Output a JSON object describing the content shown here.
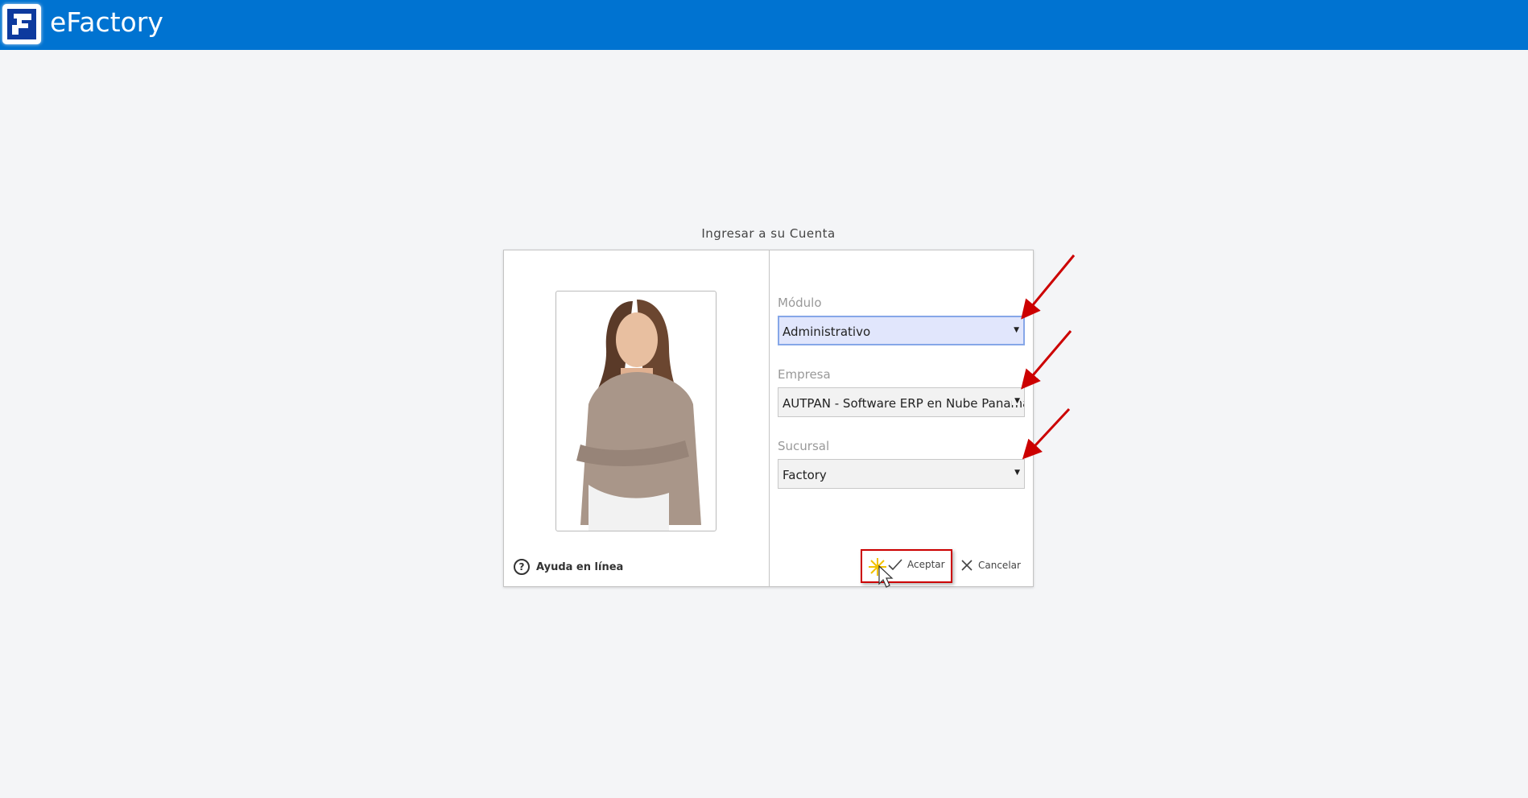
{
  "header": {
    "app_title": "eFactory",
    "logo_icon": "efactory-logo-icon"
  },
  "dialog": {
    "title": "Ingresar a su Cuenta",
    "help_label": "Ayuda en línea",
    "fields": [
      {
        "label": "Módulo",
        "value": "Administrativo"
      },
      {
        "label": "Empresa",
        "value": "AUTPAN - Software ERP en Nube Panamá"
      },
      {
        "label": "Sucursal",
        "value": "Factory"
      }
    ],
    "accept_label": "Aceptar",
    "cancel_label": "Cancelar"
  },
  "colors": {
    "header": "#0073d1",
    "annotation": "#cc0000",
    "focus_bg": "#e1e6fc"
  }
}
